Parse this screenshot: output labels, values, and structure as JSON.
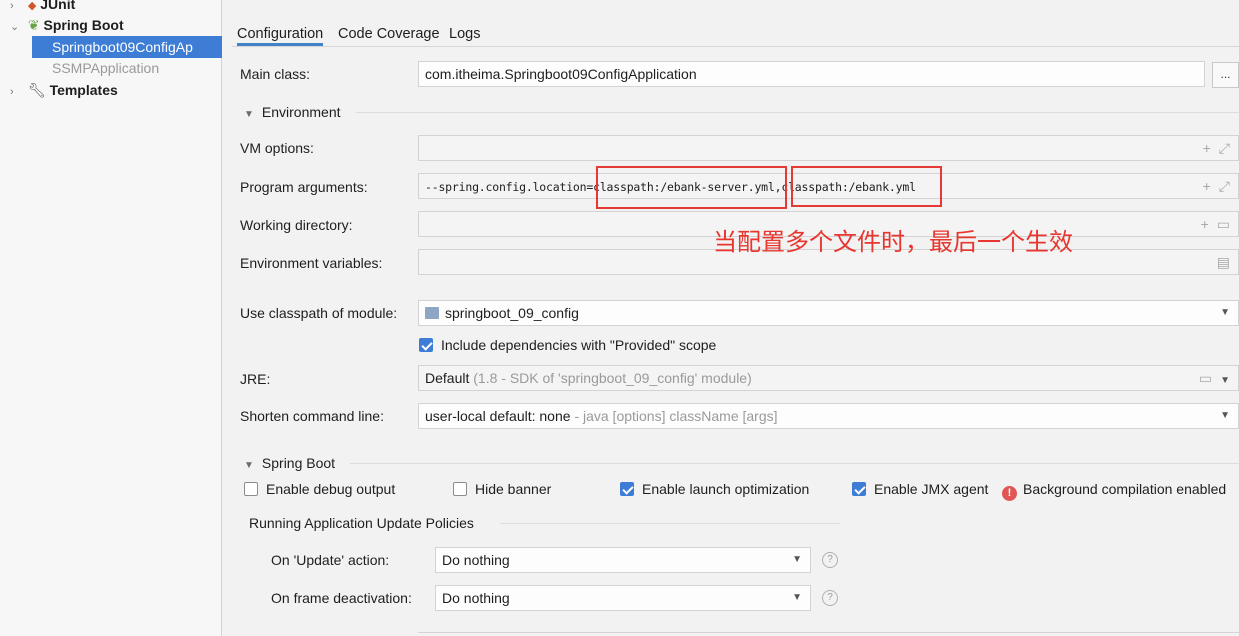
{
  "sidebar": {
    "items": [
      {
        "label": "JUnit"
      },
      {
        "label": "Spring Boot"
      },
      {
        "label": "Springboot09ConfigAp"
      },
      {
        "label": "SSMPApplication"
      },
      {
        "label": "Templates"
      }
    ]
  },
  "tabs": [
    "Configuration",
    "Code Coverage",
    "Logs"
  ],
  "main_class": {
    "label": "Main class:",
    "value": "com.itheima.Springboot09ConfigApplication",
    "browse": "..."
  },
  "environment": {
    "title": "Environment",
    "vm_options": {
      "label": "VM options:",
      "value": ""
    },
    "program_arguments": {
      "label": "Program arguments:",
      "value": "--spring.config.location=classpath:/ebank-server.yml,classpath:/ebank.yml"
    },
    "working_directory": {
      "label": "Working directory:",
      "value": ""
    },
    "environment_variables": {
      "label": "Environment variables:",
      "value": ""
    }
  },
  "annotation": "当配置多个文件时，最后一个生效",
  "classpath_module": {
    "label": "Use classpath of module:",
    "value": "springboot_09_config"
  },
  "include_provided": {
    "label": "Include dependencies with \"Provided\" scope",
    "checked": true
  },
  "jre": {
    "label": "JRE:",
    "value": "Default",
    "hint": "(1.8 - SDK of 'springboot_09_config' module)"
  },
  "shorten": {
    "label": "Shorten command line:",
    "value": "user-local default: none",
    "hint": "- java [options] className [args]"
  },
  "spring_boot": {
    "title": "Spring Boot",
    "debug_output": {
      "label": "Enable debug output",
      "checked": false
    },
    "hide_banner": {
      "label": "Hide banner",
      "checked": false
    },
    "launch_opt": {
      "label": "Enable launch optimization",
      "checked": true
    },
    "jmx_agent": {
      "label": "Enable JMX agent",
      "checked": true
    },
    "bg_compile": "Background compilation enabled"
  },
  "update_policies": {
    "title": "Running Application Update Policies",
    "on_update": {
      "label": "On 'Update' action:",
      "value": "Do nothing"
    },
    "on_frame": {
      "label": "On frame deactivation:",
      "value": "Do nothing"
    }
  },
  "colors": {
    "accent": "#3d7dd6",
    "annotation": "#e8362f"
  }
}
